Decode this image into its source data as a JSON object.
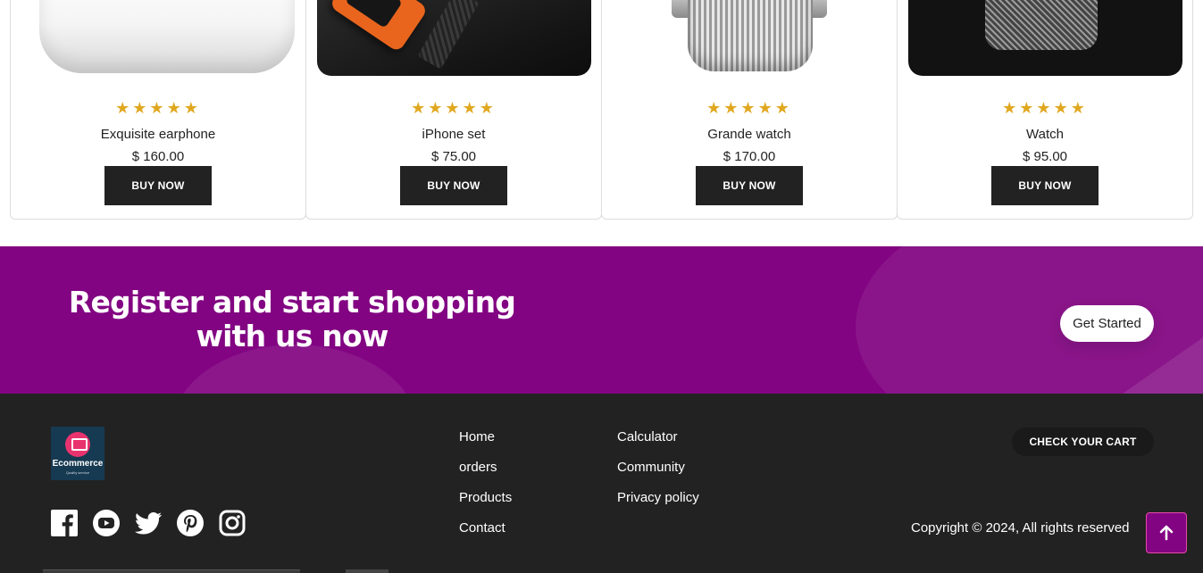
{
  "products": [
    {
      "name": "Exquisite earphone",
      "price": "$ 160.00",
      "rating": 5,
      "stars": "★★★★★",
      "buy_label": "BUY NOW"
    },
    {
      "name": "iPhone set",
      "price": "$ 75.00",
      "rating": 5,
      "stars": "★★★★★",
      "buy_label": "BUY NOW"
    },
    {
      "name": "Grande watch",
      "price": "$ 170.00",
      "rating": 5,
      "stars": "★★★★★",
      "buy_label": "BUY NOW"
    },
    {
      "name": "Watch",
      "price": "$ 95.00",
      "rating": 5,
      "stars": "★★★★★",
      "buy_label": "BUY NOW"
    }
  ],
  "banner": {
    "heading": "Register and start shopping with us now",
    "cta_label": "Get Started",
    "background_color": "#820482"
  },
  "footer": {
    "logo": {
      "brand": "Ecommerce",
      "tagline": "Quality service"
    },
    "social_icons": [
      "facebook-icon",
      "youtube-icon",
      "twitter-icon",
      "pinterest-icon",
      "instagram-icon"
    ],
    "links_col1": [
      "Home",
      "orders",
      "Products",
      "Contact"
    ],
    "links_col2": [
      "Calculator",
      "Community",
      "Privacy policy"
    ],
    "cart_label": "CHECK YOUR CART",
    "copyright": "Copyright © 2024, All rights reserved",
    "background_color": "#222222"
  },
  "accent_colors": {
    "star": "#e0a820",
    "button_dark": "#222222",
    "scroll_top": "#820482"
  }
}
